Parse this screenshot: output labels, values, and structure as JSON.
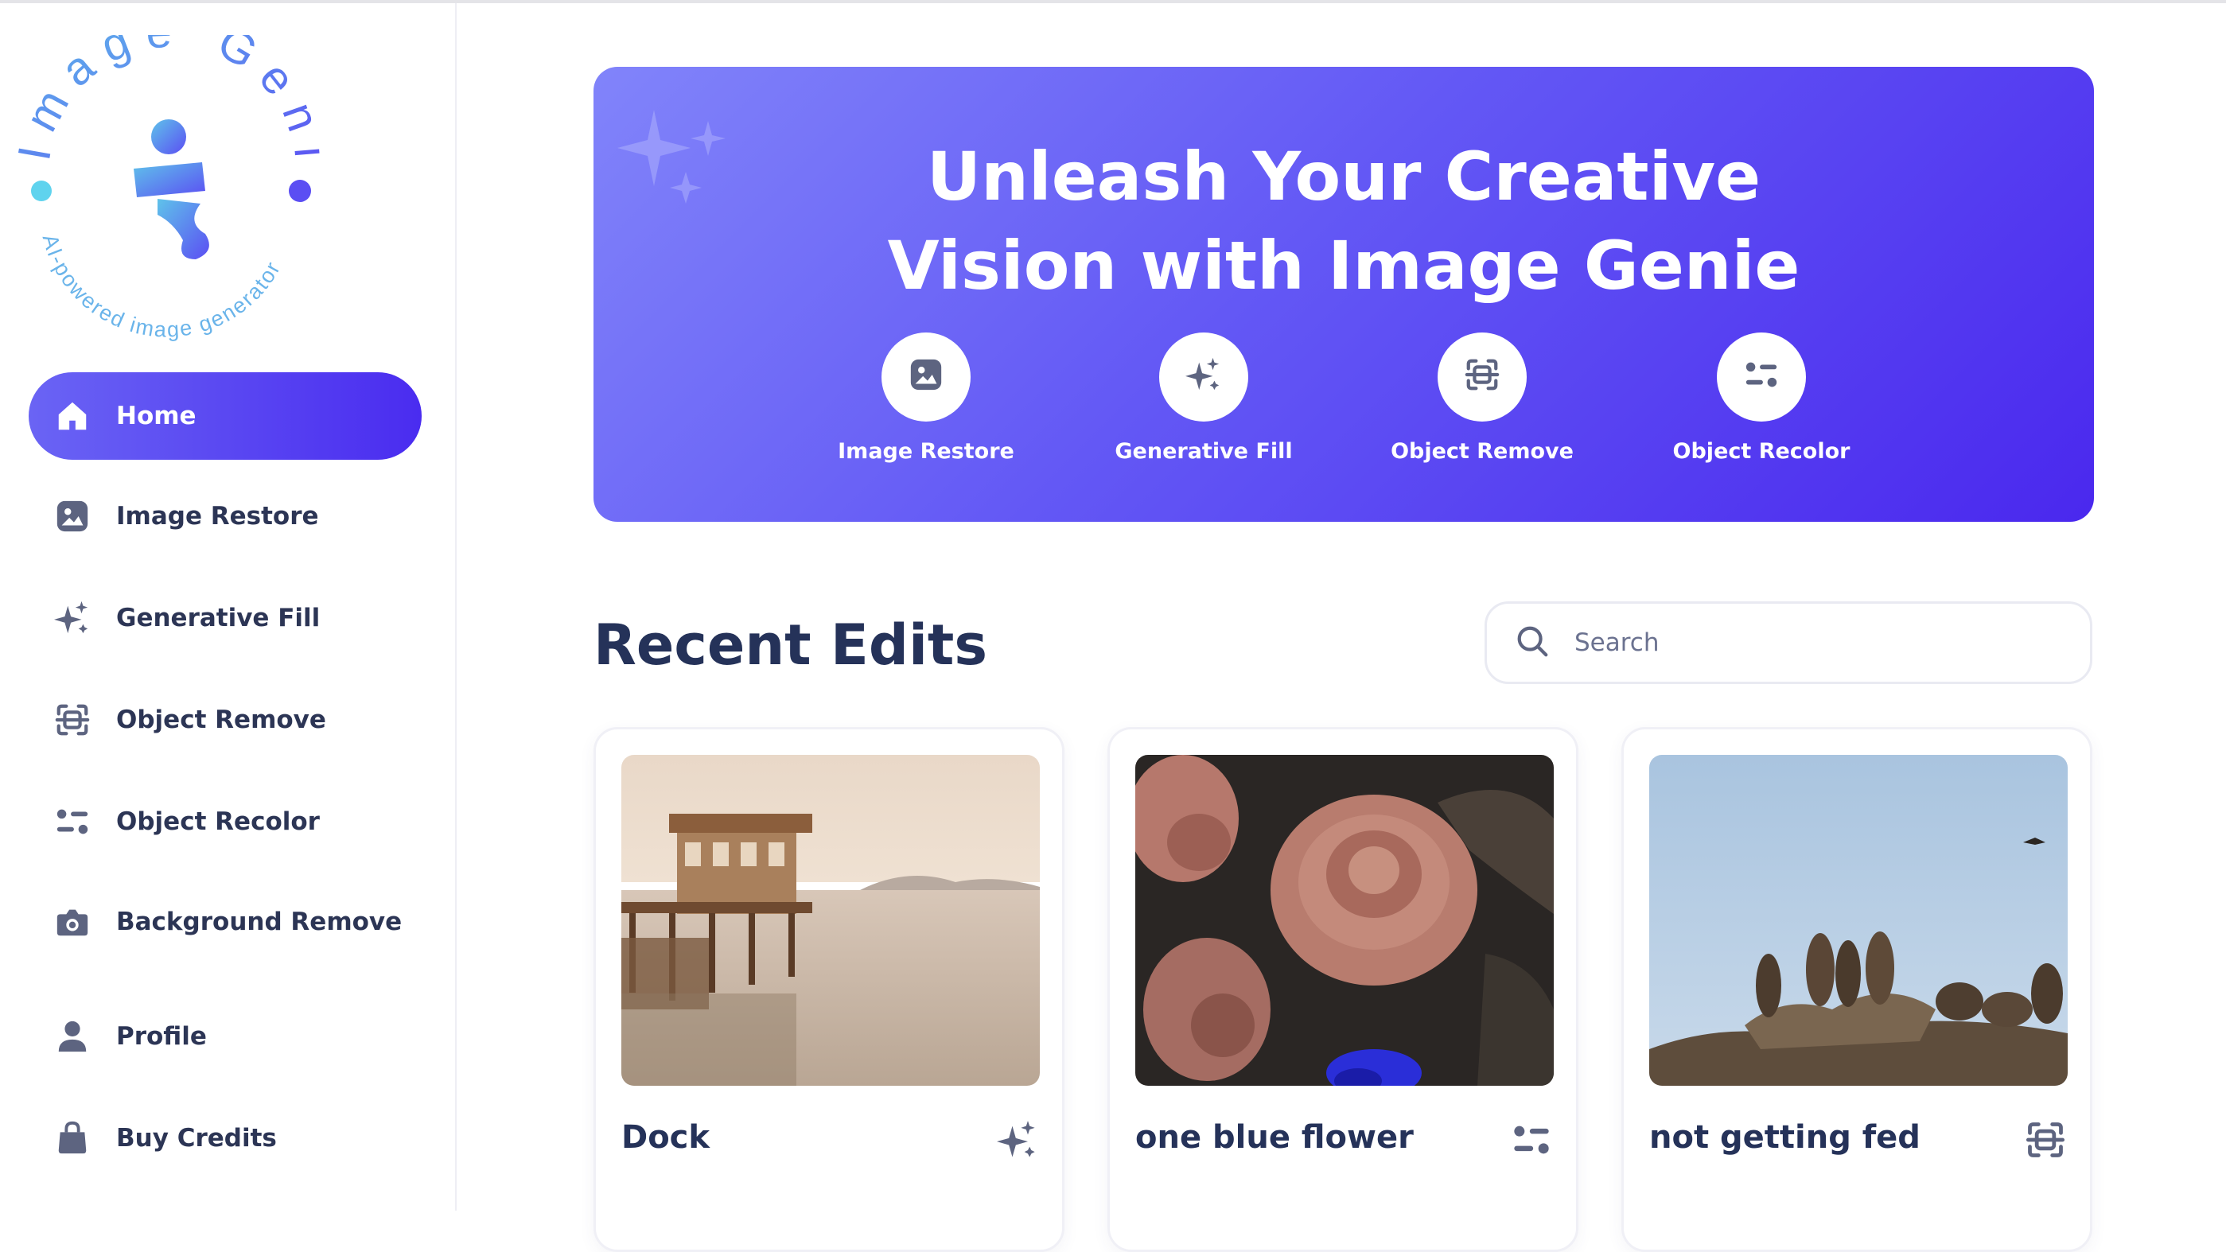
{
  "brand": {
    "name": "Image Genie",
    "tagline": "AI-powered image generator"
  },
  "sidebar": {
    "items": [
      {
        "label": "Home",
        "icon": "home-icon",
        "active": true
      },
      {
        "label": "Image Restore",
        "icon": "image-icon"
      },
      {
        "label": "Generative Fill",
        "icon": "sparkles-icon"
      },
      {
        "label": "Object Remove",
        "icon": "scan-icon"
      },
      {
        "label": "Object Recolor",
        "icon": "sliders-icon"
      },
      {
        "label": "Background Remove",
        "icon": "camera-icon"
      },
      {
        "label": "Profile",
        "icon": "user-icon"
      },
      {
        "label": "Buy Credits",
        "icon": "bag-icon"
      }
    ]
  },
  "hero": {
    "title_line1": "Unleash Your Creative",
    "title_line2": "Vision with Image Genie",
    "tools": [
      {
        "label": "Image Restore",
        "icon": "image-icon"
      },
      {
        "label": "Generative Fill",
        "icon": "sparkles-icon"
      },
      {
        "label": "Object Remove",
        "icon": "scan-icon"
      },
      {
        "label": "Object Recolor",
        "icon": "sliders-icon"
      }
    ]
  },
  "recent": {
    "title": "Recent Edits",
    "search_placeholder": "Search",
    "cards": [
      {
        "title": "Dock",
        "icon": "sparkles-icon"
      },
      {
        "title": "one blue flower",
        "icon": "sliders-icon"
      },
      {
        "title": "not getting fed",
        "icon": "scan-icon"
      }
    ]
  },
  "colors": {
    "accent": "#5b4ef3",
    "text_dark": "#253259",
    "icon_gray": "#5d6480"
  }
}
